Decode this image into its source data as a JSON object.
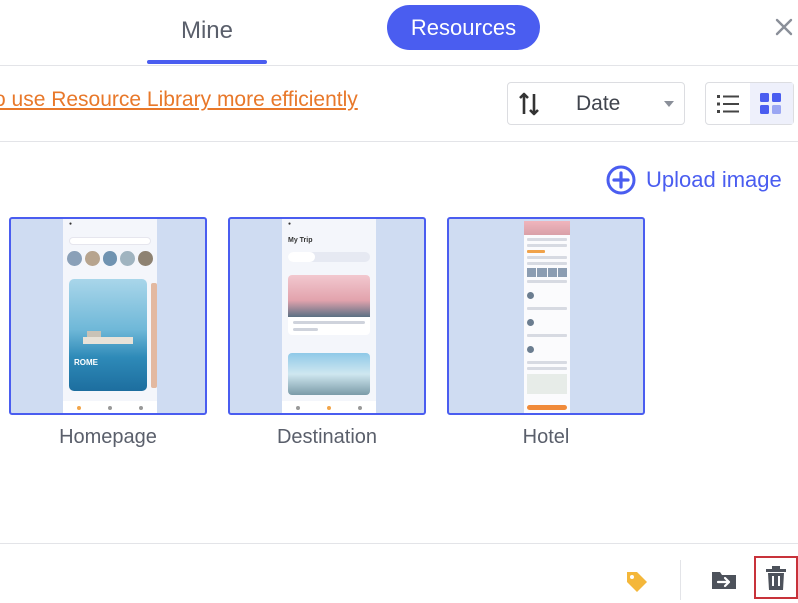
{
  "header": {
    "tabs": [
      {
        "label": "Mine",
        "active": true
      },
      {
        "label": "Resources",
        "active": false
      }
    ]
  },
  "toolbar": {
    "tip_text": "o use Resource Library more efficiently",
    "sort_label": "Date"
  },
  "upload": {
    "label": "Upload image"
  },
  "cards": [
    {
      "label": "Homepage"
    },
    {
      "label": "Destination"
    },
    {
      "label": "Hotel"
    }
  ],
  "mockups": {
    "homepage_hero_text": "ROME",
    "destination_title": "My Trip"
  },
  "colors": {
    "accent": "#4a5df0",
    "link_orange": "#e8782a",
    "tag_yellow": "#f4b73a",
    "delete_highlight": "#c8323a"
  },
  "icons": {
    "close": "close-icon",
    "sort": "sort-icon",
    "caret": "caret-down-icon",
    "list_view": "list-view-icon",
    "grid_view": "grid-view-icon",
    "upload": "plus-circle-icon",
    "tag": "tag-icon",
    "move": "move-to-icon",
    "delete": "trash-icon"
  }
}
